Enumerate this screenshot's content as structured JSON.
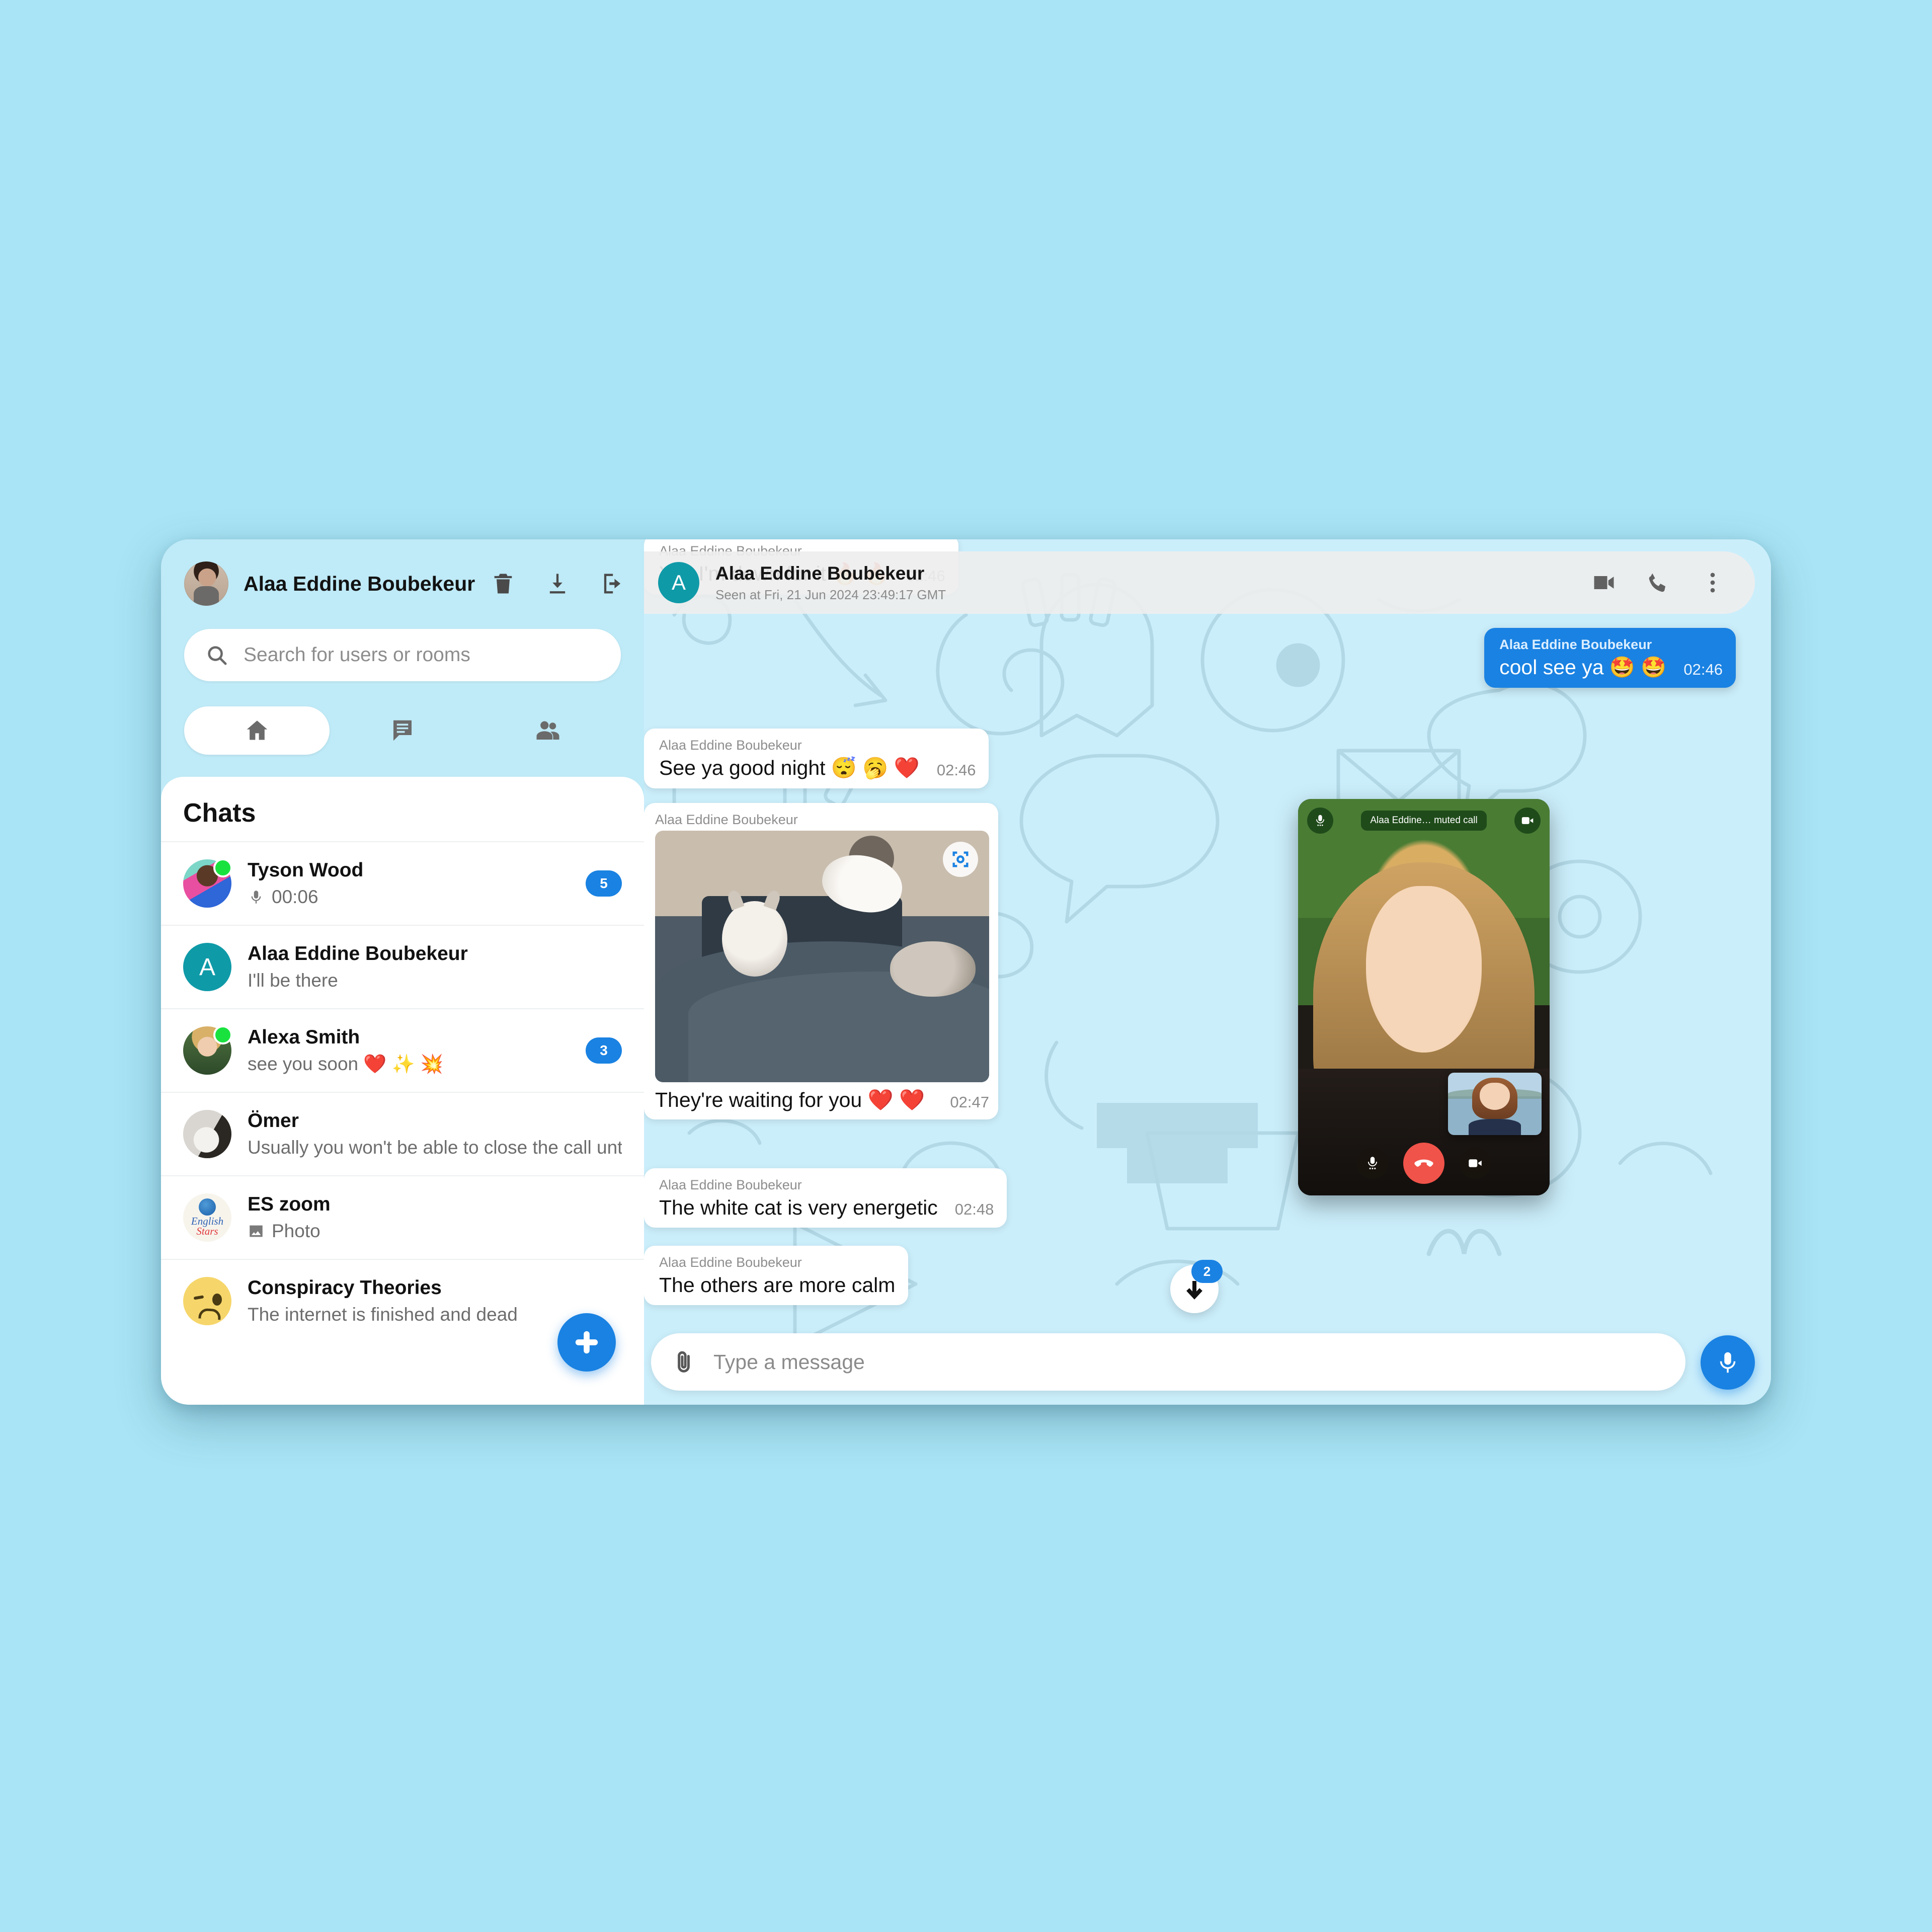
{
  "app": {
    "background_color": "#a8e4f5",
    "accent_color": "#1a82e2"
  },
  "sidebar": {
    "profile": {
      "name": "Alaa Eddine Boubekeur",
      "avatar_icon": "user-photo-avatar"
    },
    "header_icons": [
      {
        "name": "delete-icon",
        "label": "Delete"
      },
      {
        "name": "download-icon",
        "label": "Download"
      },
      {
        "name": "logout-icon",
        "label": "Logout"
      }
    ],
    "search": {
      "placeholder": "Search for users or rooms",
      "value": "",
      "icon": "search-icon"
    },
    "tabs": [
      {
        "id": "home",
        "icon": "home-icon",
        "active": true
      },
      {
        "id": "chats",
        "icon": "chat-bubble-icon",
        "active": false
      },
      {
        "id": "people",
        "icon": "people-icon",
        "active": false
      }
    ],
    "chats_title": "Chats",
    "chats": [
      {
        "name": "Tyson Wood",
        "preview": "00:06",
        "preview_icon": "microphone-icon",
        "badge": "5",
        "online": true
      },
      {
        "name": "Alaa Eddine Boubekeur",
        "preview": "I'll be there",
        "preview_icon": "",
        "badge": "",
        "online": false,
        "initial": "A"
      },
      {
        "name": "Alexa Smith",
        "preview": "see you soon ❤️ ✨ 💥",
        "preview_icon": "",
        "badge": "3",
        "online": true
      },
      {
        "name": "Ömer",
        "preview": "Usually you won't be able to close the call until…",
        "preview_icon": "",
        "badge": "",
        "online": false
      },
      {
        "name": "ES zoom",
        "preview": "Photo",
        "preview_icon": "image-icon",
        "badge": "",
        "online": false,
        "logo_line1": "English",
        "logo_line2": "Stars"
      },
      {
        "name": "Conspiracy Theories",
        "preview": "The internet is finished and dead",
        "preview_icon": "",
        "badge": "",
        "online": false
      }
    ],
    "new_chat_button": {
      "icon": "plus-icon",
      "label": "New chat"
    }
  },
  "chat": {
    "header": {
      "initial": "A",
      "name": "Alaa Eddine Boubekeur",
      "status": "Seen at Fri, 21 Jun 2024 23:49:17 GMT",
      "icons": [
        {
          "name": "video-call-icon"
        },
        {
          "name": "phone-call-icon"
        },
        {
          "name": "more-vertical-icon"
        }
      ]
    },
    "messages": [
      {
        "id": "m1",
        "sender": "Alaa Eddine Boubekeur",
        "text": "Yes I'm down for it 🔥 🔥",
        "time": "02:46",
        "direction": "in",
        "type": "text"
      },
      {
        "id": "m2",
        "sender": "Alaa Eddine Boubekeur",
        "text": "cool see ya 🤩 🤩",
        "time": "02:46",
        "direction": "out",
        "type": "text"
      },
      {
        "id": "m3",
        "sender": "Alaa Eddine Boubekeur",
        "text": "See ya good night 😴 🥱 ❤️",
        "time": "02:46",
        "direction": "in",
        "type": "text"
      },
      {
        "id": "m4",
        "sender": "Alaa Eddine Boubekeur",
        "text": "They're waiting for you ❤️ ❤️",
        "time": "02:47",
        "direction": "in",
        "type": "photo",
        "photo_alt": "three kittens on a sofa",
        "photo_action_icon": "image-scan-icon"
      },
      {
        "id": "m5",
        "sender": "Alaa Eddine Boubekeur",
        "text": "The white cat is very energetic",
        "time": "02:48",
        "direction": "in",
        "type": "text"
      },
      {
        "id": "m6",
        "sender": "Alaa Eddine Boubekeur",
        "text": "The others are more calm",
        "time": "",
        "direction": "in",
        "type": "text"
      }
    ],
    "scroll_down": {
      "icon": "arrow-down-icon",
      "badge": "2"
    },
    "composer": {
      "attach_icon": "paperclip-icon",
      "placeholder": "Type a message",
      "value": "",
      "mic_icon": "microphone-icon"
    }
  },
  "call": {
    "banner": "Alaa Eddine… muted call",
    "top_left_icon": "microphone-muted-icon",
    "top_right_icon": "video-camera-icon",
    "controls": [
      {
        "name": "mic-toggle-button",
        "icon": "microphone-muted-icon"
      },
      {
        "name": "end-call-button",
        "icon": "phone-hangup-icon",
        "color": "#f0534a"
      },
      {
        "name": "camera-toggle-button",
        "icon": "video-camera-icon"
      }
    ],
    "self_view_label": "self-view"
  }
}
